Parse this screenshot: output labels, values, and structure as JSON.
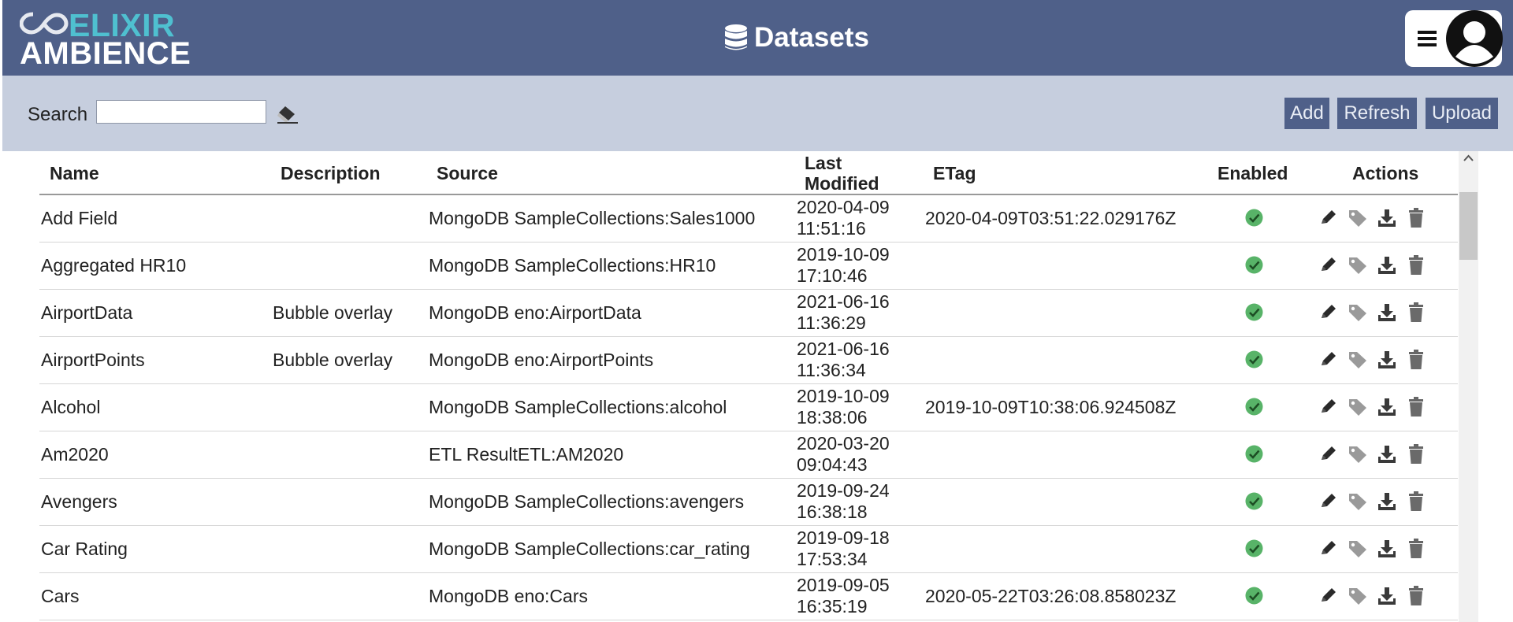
{
  "header": {
    "logo_top": "ELIXIR",
    "logo_bottom": "AMBIENCE",
    "title": "Datasets",
    "title_icon": "database-icon",
    "menu_icon": "hamburger-menu-icon",
    "avatar_icon": "user-avatar-icon",
    "color": "#4f6089"
  },
  "toolbar": {
    "search_label": "Search",
    "search_value": "",
    "search_placeholder": "",
    "clear_icon": "eraser-icon",
    "add_label": "Add",
    "refresh_label": "Refresh",
    "upload_label": "Upload",
    "color": "#c6cede"
  },
  "table": {
    "columns": [
      "Name",
      "Description",
      "Source",
      "Last Modified",
      "ETag",
      "Enabled",
      "Actions"
    ],
    "last_modified_line1": "Last",
    "last_modified_line2": "Modified",
    "action_icons": [
      "pencil-edit-icon",
      "tag-icon",
      "download-icon",
      "trash-delete-icon"
    ],
    "enabled_icon": "green-check-circle-icon",
    "rows": [
      {
        "name": "Add Field",
        "description": "",
        "source": "MongoDB SampleCollections:Sales1000",
        "date": "2020-04-09",
        "time": "11:51:16",
        "etag": "2020-04-09T03:51:22.029176Z",
        "enabled": true
      },
      {
        "name": "Aggregated HR10",
        "description": "",
        "source": "MongoDB SampleCollections:HR10",
        "date": "2019-10-09",
        "time": "17:10:46",
        "etag": "",
        "enabled": true
      },
      {
        "name": "AirportData",
        "description": "Bubble overlay",
        "source": "MongoDB eno:AirportData",
        "date": "2021-06-16",
        "time": "11:36:29",
        "etag": "",
        "enabled": true
      },
      {
        "name": "AirportPoints",
        "description": "Bubble overlay",
        "source": "MongoDB eno:AirportPoints",
        "date": "2021-06-16",
        "time": "11:36:34",
        "etag": "",
        "enabled": true
      },
      {
        "name": "Alcohol",
        "description": "",
        "source": "MongoDB SampleCollections:alcohol",
        "date": "2019-10-09",
        "time": "18:38:06",
        "etag": "2019-10-09T10:38:06.924508Z",
        "enabled": true
      },
      {
        "name": "Am2020",
        "description": "",
        "source": "ETL ResultETL:AM2020",
        "date": "2020-03-20",
        "time": "09:04:43",
        "etag": "",
        "enabled": true
      },
      {
        "name": "Avengers",
        "description": "",
        "source": "MongoDB SampleCollections:avengers",
        "date": "2019-09-24",
        "time": "16:38:18",
        "etag": "",
        "enabled": true
      },
      {
        "name": "Car Rating",
        "description": "",
        "source": "MongoDB SampleCollections:car_rating",
        "date": "2019-09-18",
        "time": "17:53:34",
        "etag": "",
        "enabled": true
      },
      {
        "name": "Cars",
        "description": "",
        "source": "MongoDB eno:Cars",
        "date": "2019-09-05",
        "time": "16:35:19",
        "etag": "2020-05-22T03:26:08.858023Z",
        "enabled": true
      }
    ]
  }
}
